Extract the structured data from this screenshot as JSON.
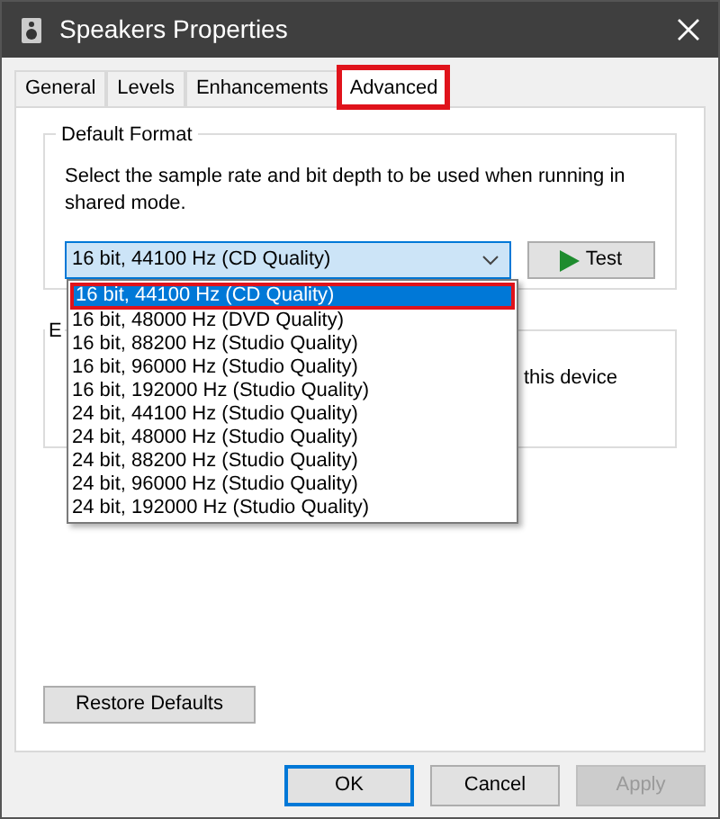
{
  "window": {
    "title": "Speakers Properties"
  },
  "tabs": [
    {
      "label": "General",
      "selected": false,
      "highlighted": false
    },
    {
      "label": "Levels",
      "selected": false,
      "highlighted": false
    },
    {
      "label": "Enhancements",
      "selected": false,
      "highlighted": false
    },
    {
      "label": "Advanced",
      "selected": true,
      "highlighted": true
    }
  ],
  "default_format": {
    "title": "Default Format",
    "description": "Select the sample rate and bit depth to be used when running in shared mode.",
    "combo_value": "16 bit, 44100 Hz (CD Quality)",
    "test_button": "Test",
    "options": [
      {
        "label": "16 bit, 44100 Hz (CD Quality)",
        "selected": true,
        "highlighted": true
      },
      {
        "label": "16 bit, 48000 Hz (DVD Quality)",
        "selected": false,
        "highlighted": false
      },
      {
        "label": "16 bit, 88200 Hz (Studio Quality)",
        "selected": false,
        "highlighted": false
      },
      {
        "label": "16 bit, 96000 Hz (Studio Quality)",
        "selected": false,
        "highlighted": false
      },
      {
        "label": "16 bit, 192000 Hz (Studio Quality)",
        "selected": false,
        "highlighted": false
      },
      {
        "label": "24 bit, 44100 Hz (Studio Quality)",
        "selected": false,
        "highlighted": false
      },
      {
        "label": "24 bit, 48000 Hz (Studio Quality)",
        "selected": false,
        "highlighted": false
      },
      {
        "label": "24 bit, 88200 Hz (Studio Quality)",
        "selected": false,
        "highlighted": false
      },
      {
        "label": "24 bit, 96000 Hz (Studio Quality)",
        "selected": false,
        "highlighted": false
      },
      {
        "label": "24 bit, 192000 Hz (Studio Quality)",
        "selected": false,
        "highlighted": false
      }
    ]
  },
  "second_group": {
    "title": "E",
    "text": "this device"
  },
  "restore_button": "Restore Defaults",
  "buttons": [
    {
      "label": "OK",
      "disabled": false,
      "default": true
    },
    {
      "label": "Cancel",
      "disabled": false,
      "default": false
    },
    {
      "label": "Apply",
      "disabled": true,
      "default": false
    }
  ]
}
